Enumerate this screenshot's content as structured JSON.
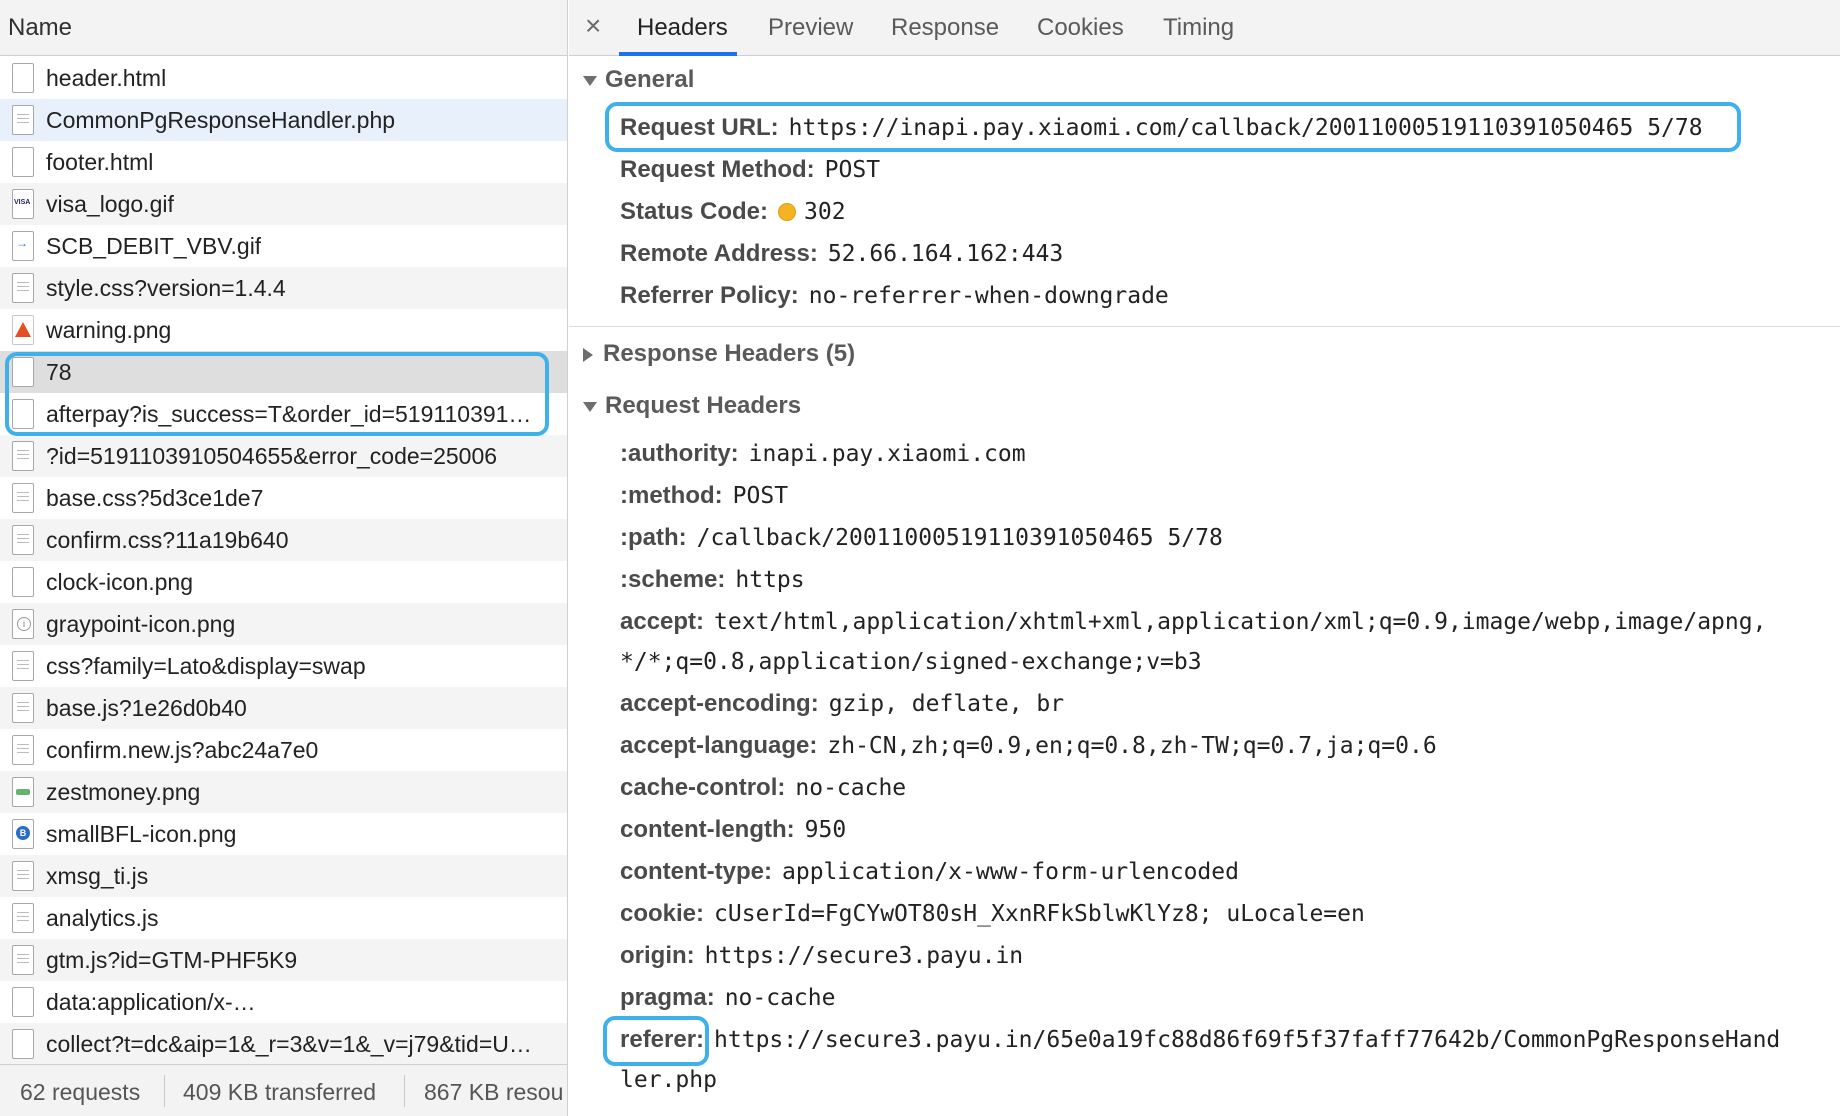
{
  "left_panel": {
    "column_header": "Name",
    "requests": [
      {
        "name": "header.html",
        "icon": "blank-file-icon"
      },
      {
        "name": "CommonPgResponseHandler.php",
        "icon": "document-icon"
      },
      {
        "name": "footer.html",
        "icon": "blank-file-icon"
      },
      {
        "name": "visa_logo.gif",
        "icon": "visa-image-icon"
      },
      {
        "name": "SCB_DEBIT_VBV.gif",
        "icon": "arrow-image-icon"
      },
      {
        "name": "style.css?version=1.4.4",
        "icon": "document-icon"
      },
      {
        "name": "warning.png",
        "icon": "warning-image-icon"
      },
      {
        "name": "78",
        "icon": "blank-file-icon"
      },
      {
        "name": "afterpay?is_success=T&order_id=519110391…",
        "icon": "blank-file-icon"
      },
      {
        "name": "?id=5191103910504655&error_code=25006",
        "icon": "document-icon"
      },
      {
        "name": "base.css?5d3ce1de7",
        "icon": "document-icon"
      },
      {
        "name": "confirm.css?11a19b640",
        "icon": "document-icon"
      },
      {
        "name": "clock-icon.png",
        "icon": "blank-file-icon"
      },
      {
        "name": "graypoint-icon.png",
        "icon": "info-image-icon"
      },
      {
        "name": "css?family=Lato&display=swap",
        "icon": "document-icon"
      },
      {
        "name": "base.js?1e26d0b40",
        "icon": "document-icon"
      },
      {
        "name": "confirm.new.js?abc24a7e0",
        "icon": "document-icon"
      },
      {
        "name": "zestmoney.png",
        "icon": "green-image-icon"
      },
      {
        "name": "smallBFL-icon.png",
        "icon": "blue-badge-image-icon"
      },
      {
        "name": "xmsg_ti.js",
        "icon": "document-icon"
      },
      {
        "name": "analytics.js",
        "icon": "document-icon"
      },
      {
        "name": "gtm.js?id=GTM-PHF5K9",
        "icon": "document-icon"
      },
      {
        "name": "data:application/x-…",
        "icon": "blank-file-icon"
      },
      {
        "name": "collect?t=dc&aip=1&_r=3&v=1&_v=j79&tid=U…",
        "icon": "blank-file-icon"
      }
    ],
    "footer": {
      "requests": "62 requests",
      "transferred": "409 KB transferred",
      "resources": "867 KB resou"
    }
  },
  "right_panel": {
    "close_glyph": "×",
    "tabs": [
      "Headers",
      "Preview",
      "Response",
      "Cookies",
      "Timing"
    ],
    "active_tab": "Headers",
    "general": {
      "title": "General",
      "request_url_key": "Request URL:",
      "request_url": "https://inapi.pay.xiaomi.com/callback/20011000519110391050465 5/78",
      "request_method_key": "Request Method:",
      "request_method": "POST",
      "status_code_key": "Status Code:",
      "status_code": "302",
      "remote_address_key": "Remote Address:",
      "remote_address": "52.66.164.162:443",
      "referrer_policy_key": "Referrer Policy:",
      "referrer_policy": "no-referrer-when-downgrade"
    },
    "response_headers": {
      "title": "Response Headers (5)"
    },
    "request_headers": {
      "title": "Request Headers",
      "items": [
        {
          "key": ":authority:",
          "value": "inapi.pay.xiaomi.com"
        },
        {
          "key": ":method:",
          "value": "POST"
        },
        {
          "key": ":path:",
          "value": "/callback/20011000519110391050465 5/78"
        },
        {
          "key": ":scheme:",
          "value": "https"
        },
        {
          "key": "accept:",
          "value": "text/html,application/xhtml+xml,application/xml;q=0.9,image/webp,image/apng,",
          "continuation": "*/*;q=0.8,application/signed-exchange;v=b3"
        },
        {
          "key": "accept-encoding:",
          "value": "gzip, deflate, br"
        },
        {
          "key": "accept-language:",
          "value": "zh-CN,zh;q=0.9,en;q=0.8,zh-TW;q=0.7,ja;q=0.6"
        },
        {
          "key": "cache-control:",
          "value": "no-cache"
        },
        {
          "key": "content-length:",
          "value": "950"
        },
        {
          "key": "content-type:",
          "value": "application/x-www-form-urlencoded"
        },
        {
          "key": "cookie:",
          "value": "cUserId=FgCYwOT80sH_XxnRFkSblwKlYz8; uLocale=en"
        },
        {
          "key": "origin:",
          "value": "https://secure3.payu.in"
        },
        {
          "key": "pragma:",
          "value": "no-cache"
        },
        {
          "key": "referer:",
          "value": "https://secure3.payu.in/65e0a19fc88d86f69f5f37faff77642b/CommonPgResponseHand",
          "continuation": "ler.php"
        }
      ]
    }
  },
  "colors": {
    "callout_border": "#3cb1ea",
    "tab_underline": "#1a73e8",
    "status_dot": "#f5b324",
    "selected_row": "#e8f0fc",
    "highlighted_row": "#dedede"
  }
}
